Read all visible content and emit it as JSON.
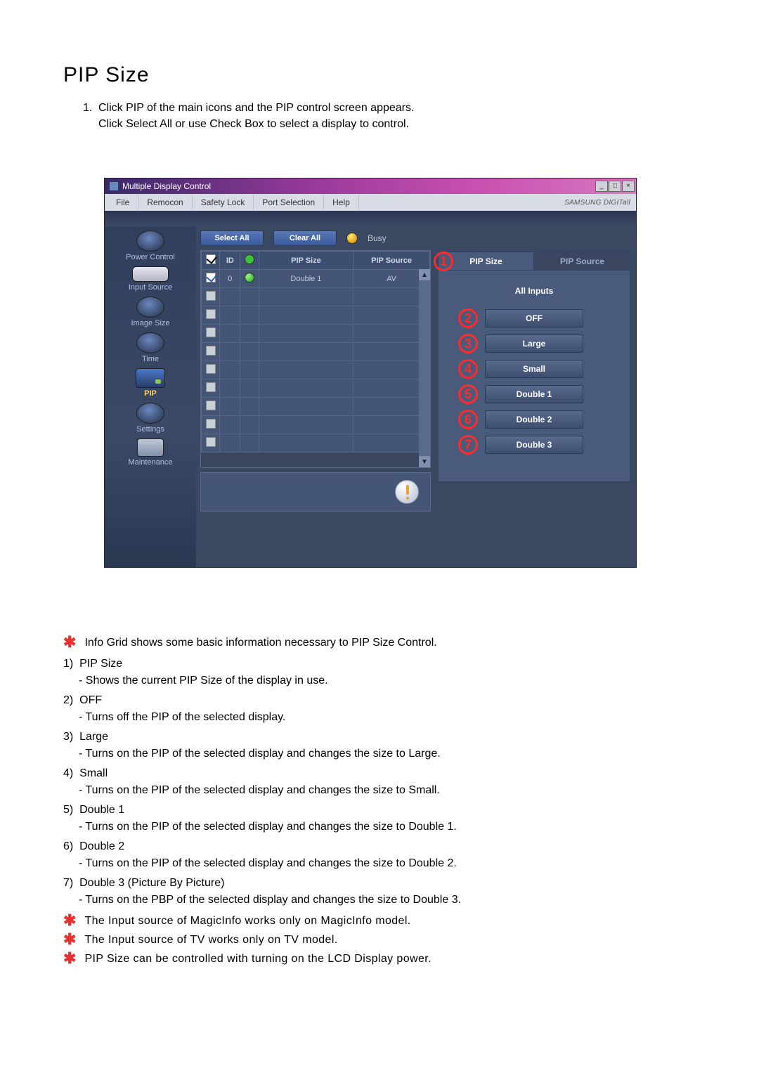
{
  "title": "PIP Size",
  "intro_num": "1.",
  "intro_line1": "Click PIP of the main icons and the PIP control screen appears.",
  "intro_line2": "Click Select All or use Check Box to select a display to control.",
  "window_title": "Multiple Display Control",
  "menu": [
    "File",
    "Remocon",
    "Safety Lock",
    "Port Selection",
    "Help"
  ],
  "brand": "SAMSUNG DIGITall",
  "sidebar": {
    "items": [
      {
        "label": "Power Control"
      },
      {
        "label": "Input Source"
      },
      {
        "label": "Image Size"
      },
      {
        "label": "Time"
      },
      {
        "label": "PIP"
      },
      {
        "label": "Settings"
      },
      {
        "label": "Maintenance"
      }
    ]
  },
  "toolbar": {
    "select_all": "Select All",
    "clear_all": "Clear All",
    "status": "Busy"
  },
  "grid": {
    "headers": {
      "id": "ID",
      "pip_size": "PIP Size",
      "pip_source": "PIP Source"
    },
    "row": {
      "id": "0",
      "size": "Double 1",
      "source": "AV"
    }
  },
  "tabs": {
    "pip_size": "PIP Size",
    "pip_source": "PIP Source"
  },
  "panel": {
    "subheader": "All Inputs",
    "options": [
      "OFF",
      "Large",
      "Small",
      "Double 1",
      "Double 2",
      "Double 3"
    ]
  },
  "callouts": [
    "1",
    "2",
    "3",
    "4",
    "5",
    "6",
    "7"
  ],
  "scroll": {
    "up": "▲",
    "down": "▼"
  },
  "explain": {
    "intro": "Info Grid shows some basic information necessary to PIP Size Control.",
    "items": [
      {
        "n": "1)",
        "t": "PIP Size",
        "d": "- Shows the current PIP Size of the display in use."
      },
      {
        "n": "2)",
        "t": "OFF",
        "d": "- Turns off the PIP of the selected display."
      },
      {
        "n": "3)",
        "t": "Large",
        "d": "- Turns on the PIP of the selected display and changes the size to Large."
      },
      {
        "n": "4)",
        "t": "Small",
        "d": "- Turns on the PIP of the selected display and changes the size to Small."
      },
      {
        "n": "5)",
        "t": "Double 1",
        "d": "- Turns on the PIP of the selected display and changes the size to Double 1."
      },
      {
        "n": "6)",
        "t": "Double 2",
        "d": "- Turns on the PIP of the selected display and changes the size to Double 2."
      },
      {
        "n": "7)",
        "t": "Double 3 (Picture By Picture)",
        "d": "- Turns on the PBP of the selected display and changes the size to Double 3."
      }
    ],
    "notes": [
      "The Input source of MagicInfo works only on MagicInfo model.",
      "The Input source of TV works only on TV model.",
      "PIP Size can be controlled with turning on the LCD Display power."
    ]
  }
}
